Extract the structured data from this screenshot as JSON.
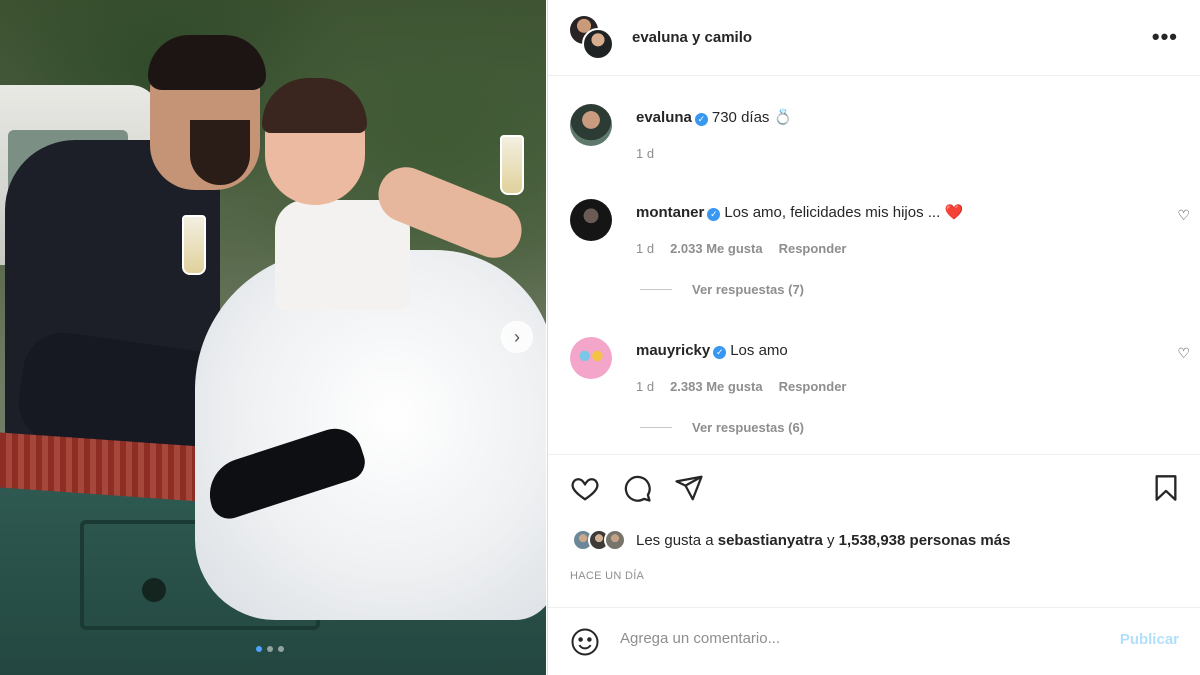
{
  "post_header": {
    "username": "evaluna y camilo",
    "more_label": "•••"
  },
  "caption": {
    "username": "evaluna",
    "text": "730 días 💍",
    "time": "1 d"
  },
  "comments": [
    {
      "username": "montaner",
      "text": "Los amo, felicidades mis hijos ...",
      "emoji": "❤️",
      "time": "1 d",
      "likes": "2.033 Me gusta",
      "reply_label": "Responder",
      "view_replies": "Ver respuestas (7)"
    },
    {
      "username": "mauyricky",
      "text": "Los amo",
      "time": "1 d",
      "likes": "2.383 Me gusta",
      "reply_label": "Responder",
      "view_replies": "Ver respuestas (6)"
    }
  ],
  "likes": {
    "prefix": "Les gusta a",
    "user": "sebastianyatra",
    "connector": "y",
    "count": "1,538,938 personas más"
  },
  "date": "HACE UN DÍA",
  "comment_form": {
    "placeholder": "Agrega un comentario...",
    "publish_label": "Publicar"
  },
  "carousel": {
    "next_label": "›",
    "current_index": 1,
    "total": 3
  },
  "icons": {
    "verified": "✓",
    "heart_small": "♡"
  },
  "colors": {
    "verified": "#3897f0",
    "publish_disabled": "#b2dffc",
    "active_dot": "#4da3ff"
  }
}
